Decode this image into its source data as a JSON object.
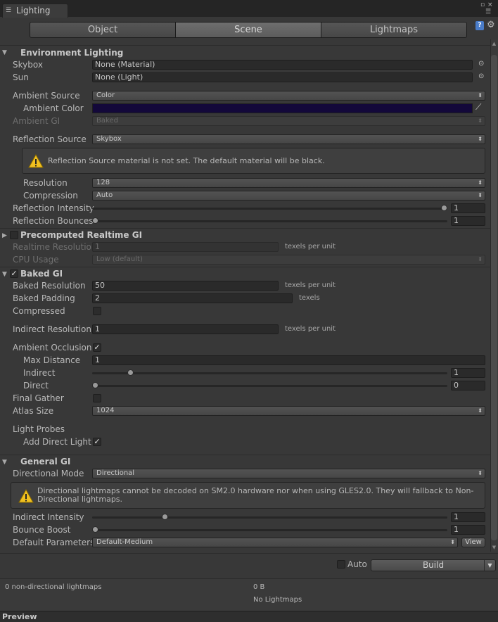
{
  "window": {
    "tab_title": "Lighting"
  },
  "tabs": [
    {
      "label": "Object"
    },
    {
      "label": "Scene"
    },
    {
      "label": "Lightmaps"
    }
  ],
  "env": {
    "header": "Environment Lighting",
    "skybox_label": "Skybox",
    "skybox_value": "None (Material)",
    "sun_label": "Sun",
    "sun_value": "None (Light)",
    "ambient_source_label": "Ambient Source",
    "ambient_source_value": "Color",
    "ambient_color_label": "Ambient Color",
    "ambient_color": "#13083a",
    "ambient_gi_label": "Ambient GI",
    "ambient_gi_value": "Baked",
    "reflection_source_label": "Reflection Source",
    "reflection_source_value": "Skybox",
    "reflection_warning": "Reflection Source material is not set. The default material will be black.",
    "resolution_label": "Resolution",
    "resolution_value": "128",
    "compression_label": "Compression",
    "compression_value": "Auto",
    "reflection_intensity_label": "Reflection Intensity",
    "reflection_intensity_value": "1",
    "reflection_intensity_level": 1.0,
    "reflection_bounces_label": "Reflection Bounces",
    "reflection_bounces_value": "1",
    "reflection_bounces_level": 0.0
  },
  "realtime": {
    "header": "Precomputed Realtime GI",
    "realtime_resolution_label": "Realtime Resolution",
    "realtime_resolution_value": "1",
    "texels_unit": "texels per unit",
    "cpu_usage_label": "CPU Usage",
    "cpu_usage_value": "Low (default)"
  },
  "baked": {
    "header": "Baked GI",
    "baked_resolution_label": "Baked Resolution",
    "baked_resolution_value": "50",
    "baked_resolution_unit": "texels per unit",
    "baked_padding_label": "Baked Padding",
    "baked_padding_value": "2",
    "baked_padding_unit": "texels",
    "compressed_label": "Compressed",
    "indirect_resolution_label": "Indirect Resolution",
    "indirect_resolution_value": "1",
    "indirect_resolution_unit": "texels per unit",
    "ambient_occlusion_label": "Ambient Occlusion",
    "max_distance_label": "Max Distance",
    "max_distance_value": "1",
    "indirect_label": "Indirect",
    "indirect_value": "1",
    "indirect_level": 0.1,
    "direct_label": "Direct",
    "direct_value": "0",
    "direct_level": 0.0,
    "final_gather_label": "Final Gather",
    "atlas_size_label": "Atlas Size",
    "atlas_size_value": "1024",
    "light_probes_label": "Light Probes",
    "add_direct_light_label": "Add Direct Light"
  },
  "general": {
    "header": "General GI",
    "directional_mode_label": "Directional Mode",
    "directional_mode_value": "Directional",
    "directional_warning": "Directional lightmaps cannot be decoded on SM2.0 hardware nor when using GLES2.0. They will fallback to Non-Directional lightmaps.",
    "indirect_intensity_label": "Indirect Intensity",
    "indirect_intensity_value": "1",
    "indirect_intensity_level": 0.2,
    "bounce_boost_label": "Bounce Boost",
    "bounce_boost_value": "1",
    "bounce_boost_level": 0.0,
    "default_parameters_label": "Default Parameters",
    "default_parameters_value": "Default-Medium",
    "view_label": "View"
  },
  "build": {
    "auto_label": "Auto",
    "build_label": "Build"
  },
  "info": {
    "lightmap_count": "0 non-directional lightmaps",
    "size": "0 B",
    "no_lightmaps": "No Lightmaps"
  },
  "preview": {
    "label": "Preview"
  }
}
